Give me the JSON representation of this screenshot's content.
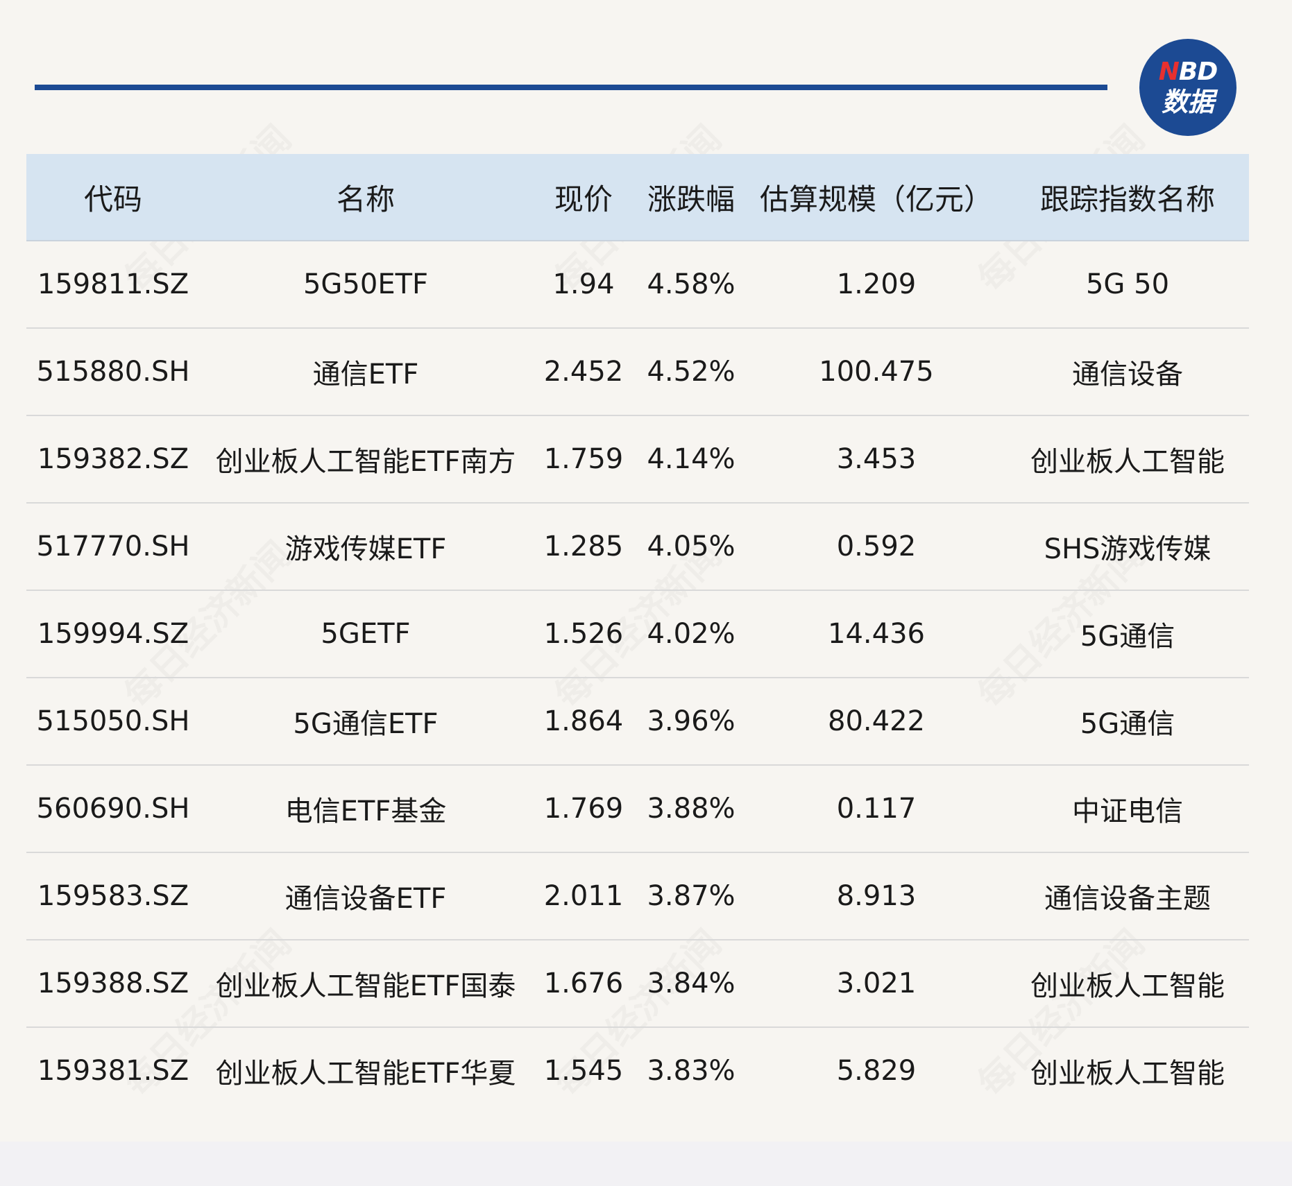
{
  "logo": {
    "line1_accent": "N",
    "line1_rest": "BD",
    "line2": "数据"
  },
  "watermark": "每日经济新闻",
  "table": {
    "headers": [
      "代码",
      "名称",
      "现价",
      "涨跌幅",
      "估算规模（亿元）",
      "跟踪指数名称"
    ],
    "rows": [
      [
        "159811.SZ",
        "5G50ETF",
        "1.94",
        "4.58%",
        "1.209",
        "5G 50"
      ],
      [
        "515880.SH",
        "通信ETF",
        "2.452",
        "4.52%",
        "100.475",
        "通信设备"
      ],
      [
        "159382.SZ",
        "创业板人工智能ETF南方",
        "1.759",
        "4.14%",
        "3.453",
        "创业板人工智能"
      ],
      [
        "517770.SH",
        "游戏传媒ETF",
        "1.285",
        "4.05%",
        "0.592",
        "SHS游戏传媒"
      ],
      [
        "159994.SZ",
        "5GETF",
        "1.526",
        "4.02%",
        "14.436",
        "5G通信"
      ],
      [
        "515050.SH",
        "5G通信ETF",
        "1.864",
        "3.96%",
        "80.422",
        "5G通信"
      ],
      [
        "560690.SH",
        "电信ETF基金",
        "1.769",
        "3.88%",
        "0.117",
        "中证电信"
      ],
      [
        "159583.SZ",
        "通信设备ETF",
        "2.011",
        "3.87%",
        "8.913",
        "通信设备主题"
      ],
      [
        "159388.SZ",
        "创业板人工智能ETF国泰",
        "1.676",
        "3.84%",
        "3.021",
        "创业板人工智能"
      ],
      [
        "159381.SZ",
        "创业板人工智能ETF华夏",
        "1.545",
        "3.83%",
        "5.829",
        "创业板人工智能"
      ]
    ]
  },
  "colors": {
    "brand_blue": "#1c4a93",
    "logo_accent": "#e8302f",
    "header_bg": "#d6e4f1",
    "page_bg": "#f7f5f1"
  }
}
